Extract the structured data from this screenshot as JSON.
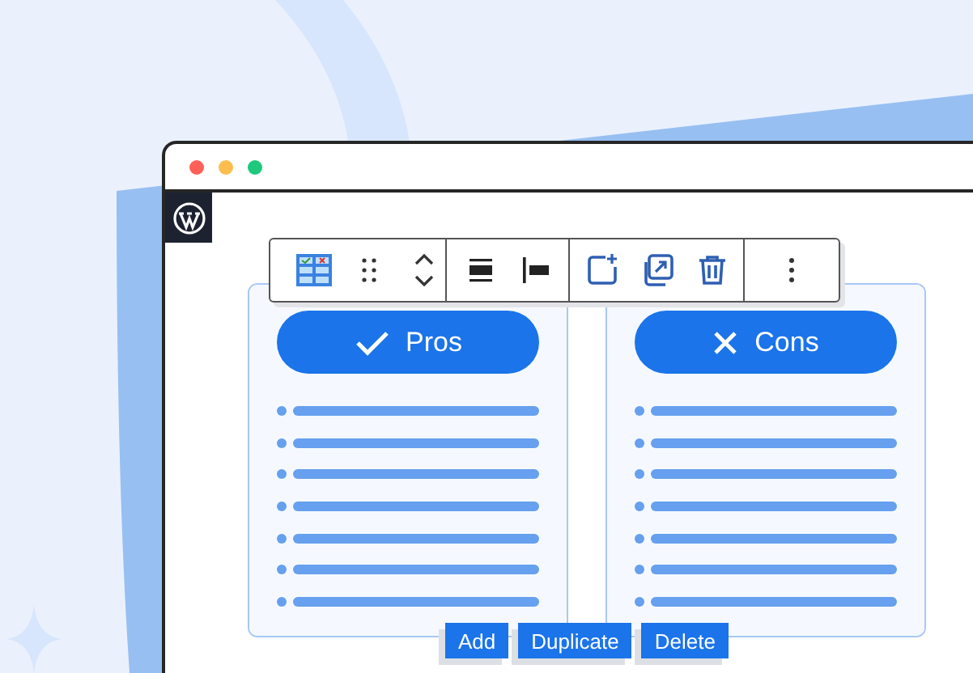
{
  "columns": [
    {
      "title": "Pros",
      "kind": "pros"
    },
    {
      "title": "Cons",
      "kind": "cons"
    }
  ],
  "block_actions": [
    "Add",
    "Duplicate",
    "Delete"
  ]
}
